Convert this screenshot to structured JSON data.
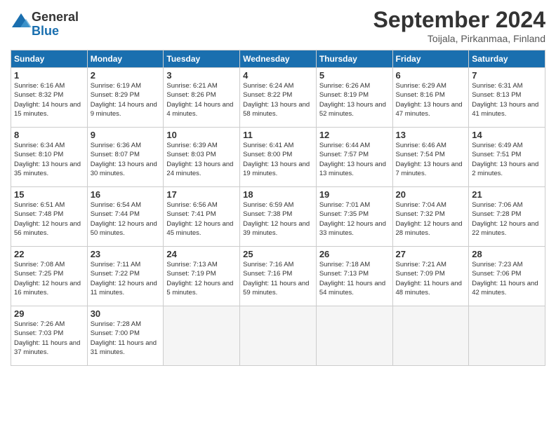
{
  "header": {
    "logo_general": "General",
    "logo_blue": "Blue",
    "title": "September 2024",
    "location": "Toijala, Pirkanmaa, Finland"
  },
  "days_of_week": [
    "Sunday",
    "Monday",
    "Tuesday",
    "Wednesday",
    "Thursday",
    "Friday",
    "Saturday"
  ],
  "weeks": [
    [
      {
        "day": "1",
        "sunrise": "6:16 AM",
        "sunset": "8:32 PM",
        "daylight": "14 hours and 15 minutes."
      },
      {
        "day": "2",
        "sunrise": "6:19 AM",
        "sunset": "8:29 PM",
        "daylight": "14 hours and 9 minutes."
      },
      {
        "day": "3",
        "sunrise": "6:21 AM",
        "sunset": "8:26 PM",
        "daylight": "14 hours and 4 minutes."
      },
      {
        "day": "4",
        "sunrise": "6:24 AM",
        "sunset": "8:22 PM",
        "daylight": "13 hours and 58 minutes."
      },
      {
        "day": "5",
        "sunrise": "6:26 AM",
        "sunset": "8:19 PM",
        "daylight": "13 hours and 52 minutes."
      },
      {
        "day": "6",
        "sunrise": "6:29 AM",
        "sunset": "8:16 PM",
        "daylight": "13 hours and 47 minutes."
      },
      {
        "day": "7",
        "sunrise": "6:31 AM",
        "sunset": "8:13 PM",
        "daylight": "13 hours and 41 minutes."
      }
    ],
    [
      {
        "day": "8",
        "sunrise": "6:34 AM",
        "sunset": "8:10 PM",
        "daylight": "13 hours and 35 minutes."
      },
      {
        "day": "9",
        "sunrise": "6:36 AM",
        "sunset": "8:07 PM",
        "daylight": "13 hours and 30 minutes."
      },
      {
        "day": "10",
        "sunrise": "6:39 AM",
        "sunset": "8:03 PM",
        "daylight": "13 hours and 24 minutes."
      },
      {
        "day": "11",
        "sunrise": "6:41 AM",
        "sunset": "8:00 PM",
        "daylight": "13 hours and 19 minutes."
      },
      {
        "day": "12",
        "sunrise": "6:44 AM",
        "sunset": "7:57 PM",
        "daylight": "13 hours and 13 minutes."
      },
      {
        "day": "13",
        "sunrise": "6:46 AM",
        "sunset": "7:54 PM",
        "daylight": "13 hours and 7 minutes."
      },
      {
        "day": "14",
        "sunrise": "6:49 AM",
        "sunset": "7:51 PM",
        "daylight": "13 hours and 2 minutes."
      }
    ],
    [
      {
        "day": "15",
        "sunrise": "6:51 AM",
        "sunset": "7:48 PM",
        "daylight": "12 hours and 56 minutes."
      },
      {
        "day": "16",
        "sunrise": "6:54 AM",
        "sunset": "7:44 PM",
        "daylight": "12 hours and 50 minutes."
      },
      {
        "day": "17",
        "sunrise": "6:56 AM",
        "sunset": "7:41 PM",
        "daylight": "12 hours and 45 minutes."
      },
      {
        "day": "18",
        "sunrise": "6:59 AM",
        "sunset": "7:38 PM",
        "daylight": "12 hours and 39 minutes."
      },
      {
        "day": "19",
        "sunrise": "7:01 AM",
        "sunset": "7:35 PM",
        "daylight": "12 hours and 33 minutes."
      },
      {
        "day": "20",
        "sunrise": "7:04 AM",
        "sunset": "7:32 PM",
        "daylight": "12 hours and 28 minutes."
      },
      {
        "day": "21",
        "sunrise": "7:06 AM",
        "sunset": "7:28 PM",
        "daylight": "12 hours and 22 minutes."
      }
    ],
    [
      {
        "day": "22",
        "sunrise": "7:08 AM",
        "sunset": "7:25 PM",
        "daylight": "12 hours and 16 minutes."
      },
      {
        "day": "23",
        "sunrise": "7:11 AM",
        "sunset": "7:22 PM",
        "daylight": "12 hours and 11 minutes."
      },
      {
        "day": "24",
        "sunrise": "7:13 AM",
        "sunset": "7:19 PM",
        "daylight": "12 hours and 5 minutes."
      },
      {
        "day": "25",
        "sunrise": "7:16 AM",
        "sunset": "7:16 PM",
        "daylight": "11 hours and 59 minutes."
      },
      {
        "day": "26",
        "sunrise": "7:18 AM",
        "sunset": "7:13 PM",
        "daylight": "11 hours and 54 minutes."
      },
      {
        "day": "27",
        "sunrise": "7:21 AM",
        "sunset": "7:09 PM",
        "daylight": "11 hours and 48 minutes."
      },
      {
        "day": "28",
        "sunrise": "7:23 AM",
        "sunset": "7:06 PM",
        "daylight": "11 hours and 42 minutes."
      }
    ],
    [
      {
        "day": "29",
        "sunrise": "7:26 AM",
        "sunset": "7:03 PM",
        "daylight": "11 hours and 37 minutes."
      },
      {
        "day": "30",
        "sunrise": "7:28 AM",
        "sunset": "7:00 PM",
        "daylight": "11 hours and 31 minutes."
      },
      null,
      null,
      null,
      null,
      null
    ]
  ]
}
